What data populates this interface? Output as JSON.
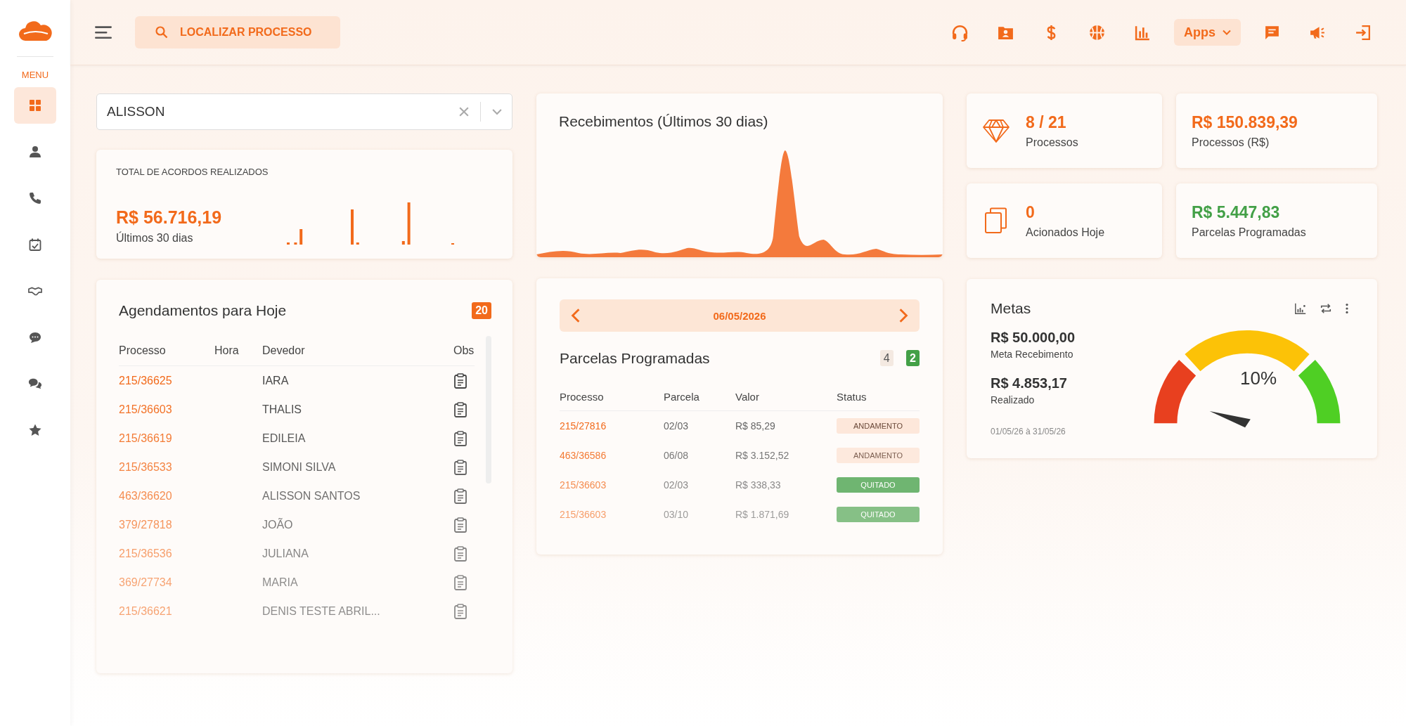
{
  "sidebar": {
    "menu_label": "MENU",
    "items": [
      {
        "selected": true
      },
      {
        "selected": false
      },
      {
        "selected": false
      },
      {
        "selected": false
      },
      {
        "selected": false
      },
      {
        "selected": false
      },
      {
        "selected": false
      },
      {
        "selected": false
      }
    ]
  },
  "topbar": {
    "search_label": "LOCALIZAR PROCESSO",
    "apps_label": "Apps"
  },
  "filter": {
    "value": "ALISSON"
  },
  "acordos": {
    "title": "TOTAL DE ACORDOS REALIZADOS",
    "value": "R$ 56.716,19",
    "caption": "Últimos 30 dias"
  },
  "recebimentos": {
    "title": "Recebimentos (Últimos 30 dias)"
  },
  "stats": [
    {
      "value": "8 / 21",
      "label": "Processos",
      "color": "#f26a1b"
    },
    {
      "value": "R$ 150.839,39",
      "label": "Processos (R$)",
      "color": "#f26a1b"
    },
    {
      "value": "0",
      "label": "Acionados Hoje",
      "color": "#f26a1b"
    },
    {
      "value": "R$ 5.447,83",
      "label": "Parcelas Programadas",
      "color": "#43a047"
    }
  ],
  "agendamentos": {
    "title": "Agendamentos para Hoje",
    "count": "20",
    "columns": [
      "Processo",
      "Hora",
      "Devedor",
      "Obs"
    ],
    "rows": [
      {
        "processo": "215/36625",
        "devedor": "IARA"
      },
      {
        "processo": "215/36603",
        "devedor": "THALIS"
      },
      {
        "processo": "215/36619",
        "devedor": "EDILEIA"
      },
      {
        "processo": "215/36533",
        "devedor": "SIMONI SILVA"
      },
      {
        "processo": "463/36620",
        "devedor": "ALISSON SANTOS"
      },
      {
        "processo": "379/27818",
        "devedor": "JOÃO"
      },
      {
        "processo": "215/36536",
        "devedor": "JULIANA"
      },
      {
        "processo": "369/27734",
        "devedor": "MARIA"
      },
      {
        "processo": "215/36621",
        "devedor": "DENIS TESTE ABRIL..."
      }
    ]
  },
  "parcelas": {
    "date": "06/05/2026",
    "title": "Parcelas Programadas",
    "count_total": "4",
    "count_paid": "2",
    "columns": [
      "Processo",
      "Parcela",
      "Valor",
      "Status"
    ],
    "rows": [
      {
        "processo": "215/27816",
        "parcela": "02/03",
        "valor": "R$ 85,29",
        "status": "ANDAMENTO",
        "kind": "pending"
      },
      {
        "processo": "463/36586",
        "parcela": "06/08",
        "valor": "R$ 3.152,52",
        "status": "ANDAMENTO",
        "kind": "pending"
      },
      {
        "processo": "215/36603",
        "parcela": "02/03",
        "valor": "R$ 338,33",
        "status": "QUITADO",
        "kind": "paid"
      },
      {
        "processo": "215/36603",
        "parcela": "03/10",
        "valor": "R$ 1.871,69",
        "status": "QUITADO",
        "kind": "paid"
      }
    ]
  },
  "metas": {
    "title": "Metas",
    "meta_value": "R$ 50.000,00",
    "meta_label": "Meta Recebimento",
    "real_value": "R$ 4.853,17",
    "real_label": "Realizado",
    "period": "01/05/26 à 31/05/26",
    "percent": "10%"
  }
}
